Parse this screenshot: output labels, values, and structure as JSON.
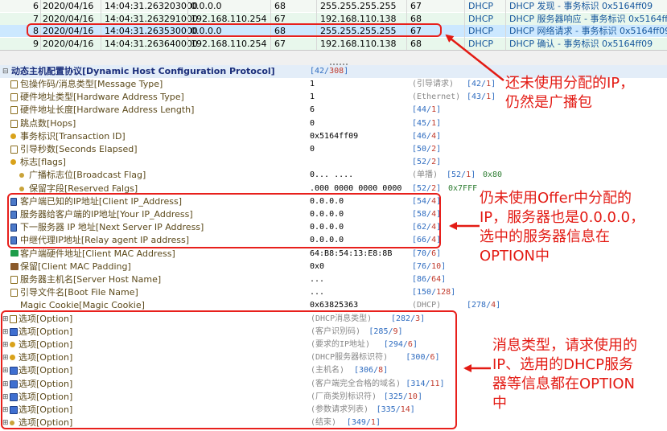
{
  "packets": [
    {
      "no": "6",
      "date": "2020/04/16",
      "time": "14:04:31.263203000",
      "src": "0.0.0.0",
      "len": "68",
      "dst": "255.255.255.255",
      "plen": "67",
      "proto": "DHCP",
      "info": "DHCP 发现 - 事务标识 0x5164ff09",
      "style": "row-alt"
    },
    {
      "no": "7",
      "date": "2020/04/16",
      "time": "14:04:31.263291000",
      "src": "192.168.110.254",
      "len": "67",
      "dst": "192.168.110.138",
      "plen": "68",
      "proto": "DHCP",
      "info": "DHCP 服务器响应 - 事务标识 0x5164ff09",
      "style": "row-green"
    },
    {
      "no": "8",
      "date": "2020/04/16",
      "time": "14:04:31.263530000",
      "src": "0.0.0.0",
      "len": "68",
      "dst": "255.255.255.255",
      "plen": "67",
      "proto": "DHCP",
      "info": "DHCP 网络请求 - 事务标识 0x5164ff09",
      "style": "row-sel"
    },
    {
      "no": "9",
      "date": "2020/04/16",
      "time": "14:04:31.263640000",
      "src": "192.168.110.254",
      "len": "67",
      "dst": "192.168.110.138",
      "plen": "68",
      "proto": "DHCP",
      "info": "DHCP 确认 - 事务标识 0x5164ff09",
      "style": "row-green"
    }
  ],
  "tree": {
    "header": {
      "label": "动态主机配置协议[Dynamic Host Configuration Protocol]",
      "offset": "[42/",
      "offset_len": "308",
      "offset_end": "]"
    },
    "fields": [
      {
        "icon": "doc",
        "label": "包操作码/消息类型[Message Type]",
        "value": "1",
        "desc": "(引导请求)",
        "off": "[42/",
        "len": "1",
        "indent": 1
      },
      {
        "icon": "doc",
        "label": "硬件地址类型[Hardware Address Type]",
        "value": "1",
        "desc": "(Ethernet)",
        "off": "[43/",
        "len": "1",
        "indent": 1
      },
      {
        "icon": "doc",
        "label": "硬件地址长度[Hardware Address Length]",
        "value": "6",
        "desc": "",
        "off": "[44/",
        "len": "1",
        "indent": 1
      },
      {
        "icon": "doc",
        "label": "跳点数[Hops]",
        "value": "0",
        "desc": "",
        "off": "[45/",
        "len": "1",
        "indent": 1
      },
      {
        "icon": "key",
        "label": "事务标识[Transaction ID]",
        "value": "0x5164ff09",
        "desc": "",
        "off": "[46/",
        "len": "4",
        "indent": 1
      },
      {
        "icon": "doc",
        "label": "引导秒数[Seconds Elapsed]",
        "value": "0",
        "desc": "",
        "off": "[50/",
        "len": "2",
        "indent": 1
      },
      {
        "icon": "key",
        "label": "标志[flags]",
        "value": "",
        "desc": "",
        "off": "[52/",
        "len": "2",
        "indent": 1
      },
      {
        "icon": "dot",
        "label": "广播标志位[Broadcast Flag]",
        "value": "0... ....",
        "desc": "(单播)",
        "off": "[52/",
        "len": "1",
        "hex": "0x80",
        "indent": 2
      },
      {
        "icon": "dot",
        "label": "保留字段[Reserved Falgs]",
        "value": ".000 0000 0000 0000",
        "desc": "",
        "off": "[52/",
        "len": "2",
        "hex": "0x7FFF",
        "indent": 2
      },
      {
        "icon": "lock",
        "label": "客户端已知的IP地址[Client IP_Address]",
        "value": "0.0.0.0",
        "desc": "",
        "off": "[54/",
        "len": "4",
        "indent": 1
      },
      {
        "icon": "lock",
        "label": "服务器给客户端的IP地址[Your IP_Address]",
        "value": "0.0.0.0",
        "desc": "",
        "off": "[58/",
        "len": "4",
        "indent": 1
      },
      {
        "icon": "lock",
        "label": "下一服务器 IP 地址[Next Server IP Address]",
        "value": "0.0.0.0",
        "desc": "",
        "off": "[62/",
        "len": "4",
        "indent": 1
      },
      {
        "icon": "lock",
        "label": "中继代理IP地址[Relay agent IP address]",
        "value": "0.0.0.0",
        "desc": "",
        "off": "[66/",
        "len": "4",
        "indent": 1
      },
      {
        "icon": "green",
        "label": "客户端硬件地址[Client MAC Address]",
        "value": "64:B8:54:13:E8:8B",
        "desc": "",
        "off": "[70/",
        "len": "6",
        "indent": 1
      },
      {
        "icon": "db",
        "label": "保留[Client MAC Padding]",
        "value": "0x0",
        "desc": "",
        "off": "[76/",
        "len": "10",
        "indent": 1
      },
      {
        "icon": "doc",
        "label": "服务器主机名[Server Host Name]",
        "value": "...",
        "desc": "",
        "off": "[86/",
        "len": "64",
        "indent": 1
      },
      {
        "icon": "doc",
        "label": "引导文件名[Boot File Name]",
        "value": "...",
        "desc": "",
        "off": "[150/",
        "len": "128",
        "indent": 1
      },
      {
        "icon": "none",
        "label": "Magic Cookie[Magic Cookie]",
        "value": "0x63825363",
        "desc": "(DHCP)",
        "off": "[278/",
        "len": "4",
        "indent": 1
      },
      {
        "icon": "doc",
        "label": "选项[Option]",
        "value": "",
        "desc": "(DHCP消息类型)",
        "off": "[282/",
        "len": "3",
        "indent": 0,
        "expand": true
      },
      {
        "icon": "blue",
        "label": "选项[Option]",
        "value": "",
        "desc": "(客户识别码)",
        "off": "[285/",
        "len": "9",
        "indent": 0,
        "expand": true
      },
      {
        "icon": "key",
        "label": "选项[Option]",
        "value": "",
        "desc": "(要求的IP地址)",
        "off": "[294/",
        "len": "6",
        "indent": 0,
        "expand": true
      },
      {
        "icon": "key",
        "label": "选项[Option]",
        "value": "",
        "desc": "(DHCP服务器标识符)",
        "off": "[300/",
        "len": "6",
        "indent": 0,
        "expand": true
      },
      {
        "icon": "blue",
        "label": "选项[Option]",
        "value": "",
        "desc": "(主机名)",
        "off": "[306/",
        "len": "8",
        "indent": 0,
        "expand": true
      },
      {
        "icon": "blue",
        "label": "选项[Option]",
        "value": "",
        "desc": "(客户端完全合格的域名)",
        "off": "[314/",
        "len": "11",
        "indent": 0,
        "expand": true
      },
      {
        "icon": "blue",
        "label": "选项[Option]",
        "value": "",
        "desc": "(厂商类别标识符)",
        "off": "[325/",
        "len": "10",
        "indent": 0,
        "expand": true
      },
      {
        "icon": "blue",
        "label": "选项[Option]",
        "value": "",
        "desc": "(参数请求列表)",
        "off": "[335/",
        "len": "14",
        "indent": 0,
        "expand": true
      },
      {
        "icon": "dot",
        "label": "选项[Option]",
        "value": "",
        "desc": "(结束)",
        "off": "[349/",
        "len": "1",
        "indent": 0,
        "expand": true
      }
    ]
  },
  "annotations": {
    "note1_line1": "还未使用分配的IP，",
    "note1_line2": "仍然是广播包",
    "note2_line1": "仍未使用Offer中分配的",
    "note2_line2": "IP，服务器也是0.0.0.0，",
    "note2_line3": "选中的服务器信息在",
    "note2_line4": "OPTION中",
    "note3_line1": "消息类型，请求使用的",
    "note3_line2": "IP、选用的DHCP服务",
    "note3_line3": "器等信息都在OPTION",
    "note3_line4": "中"
  },
  "colors": {
    "annotation": "#e31b14",
    "selected_row": "#cce8ff",
    "protocol_text": "#15569c"
  }
}
